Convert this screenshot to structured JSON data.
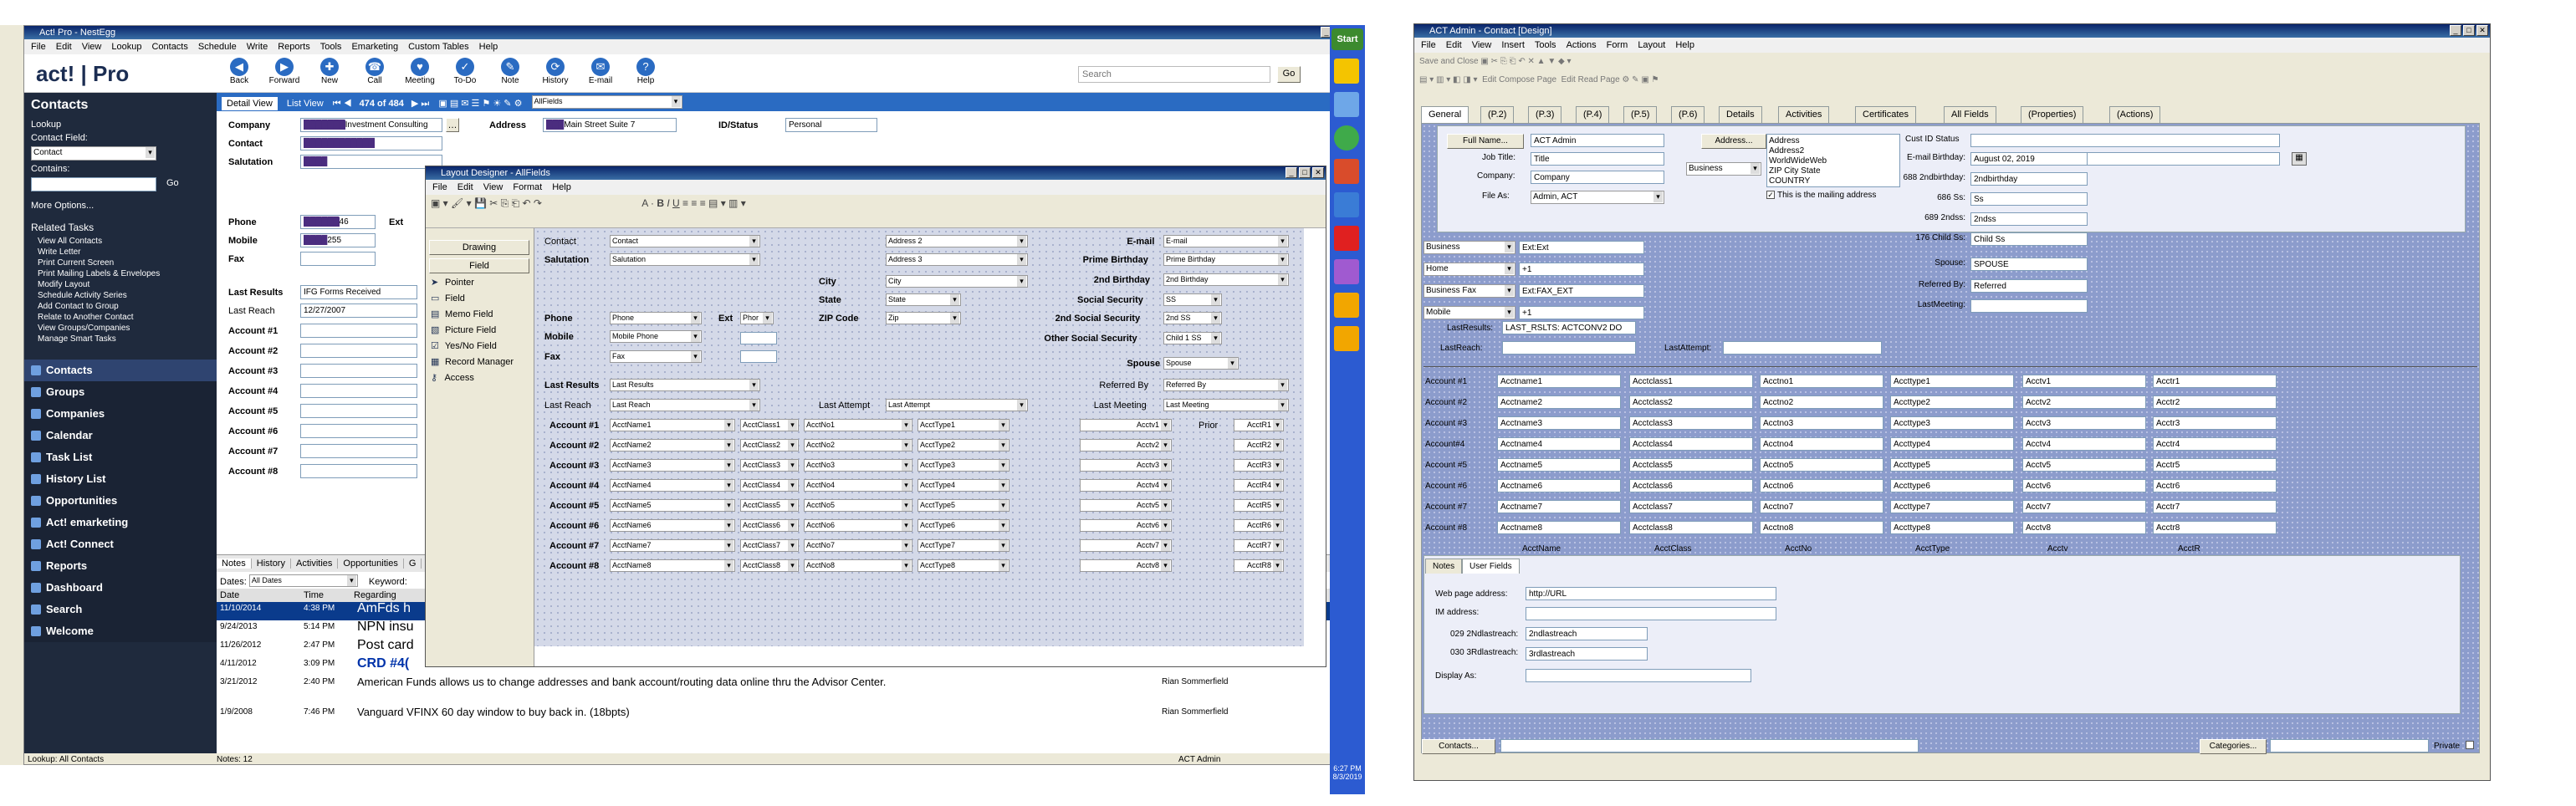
{
  "desktop": {
    "start_label": "Start",
    "clock_time": "6:27 PM",
    "clock_date": "8/3/2019"
  },
  "act_pro": {
    "title": "Act! Pro - NestEgg",
    "menu": [
      "File",
      "Edit",
      "View",
      "Lookup",
      "Contacts",
      "Schedule",
      "Write",
      "Reports",
      "Tools",
      "Emarketing",
      "Custom Tables",
      "Help"
    ],
    "toolbar": [
      "Back",
      "Forward",
      "New",
      "Call",
      "Meeting",
      "To-Do",
      "Note",
      "History",
      "E-mail",
      "Help"
    ],
    "search_placeholder": "Search",
    "go_label": "Go",
    "logo": "act! | Pro",
    "record_nav": {
      "detail_view": "Detail View",
      "list_view": "List View",
      "counter": "474 of 484",
      "layout": "AllFields"
    },
    "sidebar": {
      "title": "Contacts",
      "lookup": "Lookup",
      "contact_field_label": "Contact Field:",
      "contact_field_value": "Contact",
      "contains_label": "Contains:",
      "go": "Go",
      "more_options": "More Options...",
      "related_tasks_title": "Related Tasks",
      "tasks": [
        "View All Contacts",
        "Write Letter",
        "Print Current Screen",
        "Print Mailing Labels & Envelopes",
        "Modify Layout",
        "Schedule Activity Series",
        "Add Contact to Group",
        "Relate to Another Contact",
        "View Groups/Companies",
        "Manage Smart Tasks"
      ],
      "nav": [
        "Contacts",
        "Groups",
        "Companies",
        "Calendar",
        "Task List",
        "History List",
        "Opportunities",
        "Act! emarketing",
        "Act! Connect",
        "Reports",
        "Dashboard",
        "Search",
        "Welcome"
      ]
    },
    "fields": {
      "company_label": "Company",
      "company_value": "Investment Consulting",
      "contact_label": "Contact",
      "salutation_label": "Salutation",
      "address_label": "Address",
      "address_value": "Main Street Suite 7",
      "id_status_label": "ID/Status",
      "id_status_value": "Personal",
      "phone_label": "Phone",
      "phone_value": "46",
      "ext_label": "Ext",
      "mobile_label": "Mobile",
      "mobile_value": "255",
      "fax_label": "Fax",
      "last_results_label": "Last Results",
      "last_results_value": "IFG Forms Received",
      "last_reach_label": "Last Reach",
      "last_reach_value": "12/27/2007",
      "accounts": [
        "Account #1",
        "Account #2",
        "Account #3",
        "Account #4",
        "Account #5",
        "Account #6",
        "Account #7",
        "Account #8"
      ]
    },
    "bottom_tabs": [
      "Notes",
      "History",
      "Activities",
      "Opportunities",
      "G"
    ],
    "dates_label": "Dates:",
    "dates_value": "All Dates",
    "keyword_label": "Keyword:",
    "notes_columns": [
      "Date",
      "Time",
      "Regarding"
    ],
    "notes": [
      {
        "date": "11/10/2014",
        "time": "4:38 PM",
        "regarding": "AmFds h",
        "user": ""
      },
      {
        "date": "9/24/2013",
        "time": "5:14 PM",
        "regarding": "NPN insu",
        "user": ""
      },
      {
        "date": "11/26/2012",
        "time": "2:47 PM",
        "regarding": "Post card",
        "user": ""
      },
      {
        "date": "4/11/2012",
        "time": "3:09 PM",
        "regarding": "CRD #4(",
        "user": ""
      },
      {
        "date": "3/21/2012",
        "time": "2:40 PM",
        "regarding": "American Funds allows us to change addresses and bank account/routing data online thru the Advisor Center.",
        "user": "Rian Sommerfield"
      },
      {
        "date": "1/9/2008",
        "time": "7:46 PM",
        "regarding": "Vanguard VFINX 60 day window to buy back in. (18bpts)",
        "user": "Rian Sommerfield"
      }
    ],
    "status": {
      "lookup": "Lookup: All Contacts",
      "notes": "Notes: 12",
      "user": "ACT Admin"
    }
  },
  "layout_designer": {
    "title": "Layout Designer - AllFields",
    "menu": [
      "File",
      "Edit",
      "View",
      "Format",
      "Help"
    ],
    "toolbox": {
      "drawing": "Drawing",
      "field": "Field",
      "items": [
        "Pointer",
        "Field",
        "Memo Field",
        "Picture Field",
        "Yes/No Field",
        "Record Manager",
        "Access"
      ]
    },
    "rows": {
      "contact": {
        "label": "Contact",
        "value": "Contact"
      },
      "salutation": {
        "label": "Salutation",
        "value": "Salutation"
      },
      "city": {
        "label": "City",
        "value": "City"
      },
      "state": {
        "label": "State",
        "value": "State"
      },
      "zip": {
        "label": "ZIP Code",
        "value": "Zip"
      },
      "phone": {
        "label": "Phone",
        "value": "Phone",
        "ext": "Ext",
        "ext_value": "Phor"
      },
      "mobile": {
        "label": "Mobile",
        "value": "Mobile Phone"
      },
      "fax": {
        "label": "Fax",
        "value": "Fax"
      },
      "last_results": {
        "label": "Last Results",
        "value": "Last Results"
      },
      "last_reach": {
        "label": "Last Reach",
        "value": "Last Reach"
      },
      "last_attempt": {
        "label": "Last Attempt",
        "value": "Last Attempt"
      },
      "address2": "Address 2",
      "address3": "Address 3",
      "email": {
        "label": "E-mail",
        "value": "E-mail"
      },
      "prime_birthday": {
        "label": "Prime Birthday",
        "value": "Prime Birthday"
      },
      "birthday2": {
        "label": "2nd Birthday",
        "value": "2nd Birthday"
      },
      "ss": {
        "label": "Social Security",
        "value": "SS"
      },
      "ss2": {
        "label": "2nd Social Security",
        "value": "2nd SS"
      },
      "ss_other": {
        "label": "Other Social Security",
        "value": "Child 1 SS"
      },
      "spouse": {
        "label": "Spouse",
        "value": "Spouse"
      },
      "referred_by": {
        "label": "Referred By",
        "value": "Referred By"
      },
      "last_meeting": {
        "label": "Last Meeting",
        "value": "Last Meeting"
      }
    },
    "prior_label": "Prior",
    "accounts": [
      {
        "label": "Account #1",
        "name": "AcctName1",
        "class": "AcctClass1",
        "no": "AcctNo1",
        "type": "AcctType1",
        "v": "Acctv1",
        "r": "AcctR1"
      },
      {
        "label": "Account #2",
        "name": "AcctName2",
        "class": "AcctClass2",
        "no": "AcctNo2",
        "type": "AcctType2",
        "v": "Acctv2",
        "r": "AcctR2"
      },
      {
        "label": "Account #3",
        "name": "AcctName3",
        "class": "AcctClass3",
        "no": "AcctNo3",
        "type": "AcctType3",
        "v": "Acctv3",
        "r": "AcctR3"
      },
      {
        "label": "Account #4",
        "name": "AcctName4",
        "class": "AcctClass4",
        "no": "AcctNo4",
        "type": "AcctType4",
        "v": "Acctv4",
        "r": "AcctR4"
      },
      {
        "label": "Account #5",
        "name": "AcctName5",
        "class": "AcctClass5",
        "no": "AcctNo5",
        "type": "AcctType5",
        "v": "Acctv5",
        "r": "AcctR5"
      },
      {
        "label": "Account #6",
        "name": "AcctName6",
        "class": "AcctClass6",
        "no": "AcctNo6",
        "type": "AcctType6",
        "v": "Acctv6",
        "r": "AcctR6"
      },
      {
        "label": "Account #7",
        "name": "AcctName7",
        "class": "AcctClass7",
        "no": "AcctNo7",
        "type": "AcctType7",
        "v": "Acctv7",
        "r": "AcctR7"
      },
      {
        "label": "Account #8",
        "name": "AcctName8",
        "class": "AcctClass8",
        "no": "AcctNo8",
        "type": "AcctType8",
        "v": "Acctv8",
        "r": "AcctR8"
      }
    ]
  },
  "act_admin": {
    "title": "ACT Admin - Contact  [Design]",
    "menu": [
      "File",
      "Edit",
      "View",
      "Insert",
      "Tools",
      "Actions",
      "Form",
      "Layout",
      "Help"
    ],
    "toolbar_text": {
      "save_close": "Save and Close",
      "edit_compose": "Edit Compose Page",
      "edit_read": "Edit Read Page"
    },
    "tabs": [
      "General",
      "(P.2)",
      "(P.3)",
      "(P.4)",
      "(P.5)",
      "(P.6)",
      "Details",
      "Activities",
      "Certificates",
      "All Fields",
      "(Properties)",
      "(Actions)"
    ],
    "full_name_btn": "Full Name...",
    "full_name": "ACT Admin",
    "job_title_label": "Job Title:",
    "job_title": "Title",
    "company_label": "Company:",
    "company": "Company",
    "file_as_label": "File As:",
    "file_as": "Admin, ACT",
    "address_btn": "Address...",
    "business_label": "Business",
    "address_list": [
      "Address",
      "Address2",
      "WorldWideWeb",
      "ZIP City State",
      "COUNTRY"
    ],
    "mailing_checkbox": "This is the mailing address",
    "cust_id_label": "Cust ID Status",
    "email_label": "E-mail",
    "birthday_label": "Birthday:",
    "birthday": "August 02, 2019",
    "birthday2_label": "688 2ndbirthday:",
    "birthday2": "2ndbirthday",
    "ss_label": "686 Ss:",
    "ss": "Ss",
    "ss2_label": "689 2ndss:",
    "ss2": "2ndss",
    "child_ss_label": "176 Child Ss:",
    "child_ss": "Child Ss",
    "spouse_label": "Spouse:",
    "spouse": "SPOUSE",
    "referred_label": "Referred By:",
    "referred": "Referred",
    "last_meeting_label": "LastMeeting:",
    "phones": [
      {
        "label": "Business",
        "value": "Ext:Ext"
      },
      {
        "label": "Home",
        "value": "+1"
      },
      {
        "label": "Business Fax",
        "value": "Ext:FAX_EXT"
      },
      {
        "label": "Mobile",
        "value": "+1"
      }
    ],
    "last_results_label": "LastResults:",
    "last_results": "LAST_RSLTS: ACTCONV2 DO",
    "last_reach_label": "LastReach:",
    "last_attempt_label": "LastAttempt:",
    "accounts": [
      [
        "Account #1",
        "Acctname1",
        "Acctclass1",
        "Acctno1",
        "Accttype1",
        "Acctv1",
        "Acctr1"
      ],
      [
        "Account #2",
        "Acctname2",
        "Acctclass2",
        "Acctno2",
        "Accttype2",
        "Acctv2",
        "Acctr2"
      ],
      [
        "Account #3",
        "Acctname3",
        "Acctclass3",
        "Acctno3",
        "Accttype3",
        "Acctv3",
        "Acctr3"
      ],
      [
        "Account#4",
        "Acctname4",
        "Acctclass4",
        "Acctno4",
        "Accttype4",
        "Acctv4",
        "Acctr4"
      ],
      [
        "Account #5",
        "Acctname5",
        "Acctclass5",
        "Acctno5",
        "Accttype5",
        "Acctv5",
        "Acctr5"
      ],
      [
        "Account #6",
        "Acctname6",
        "Acctclass6",
        "Acctno6",
        "Accttype6",
        "Acctv6",
        "Acctr6"
      ],
      [
        "Account #7",
        "Acctname7",
        "Acctclass7",
        "Acctno7",
        "Accttype7",
        "Acctv7",
        "Acctr7"
      ],
      [
        "Account #8",
        "Acctname8",
        "Acctclass8",
        "Acctno8",
        "Accttype8",
        "Acctv8",
        "Acctr8"
      ]
    ],
    "account_headers": [
      "AcctName",
      "AcctClass",
      "AcctNo",
      "AcctType",
      "Acctv",
      "AcctR"
    ],
    "notes_tabs": [
      "Notes",
      "User Fields"
    ],
    "web_label": "Web page address:",
    "web": "http://URL",
    "im_label": "IM address:",
    "lastreach2_label": "029 2Ndlastreach:",
    "lastreach2": "2ndlastreach",
    "lastreach3_label": "030 3Rdlastreach:",
    "lastreach3": "3rdlastreach",
    "display_as_label": "Display As:",
    "contacts_btn": "Contacts...",
    "categories_btn": "Categories...",
    "private_label": "Private"
  }
}
